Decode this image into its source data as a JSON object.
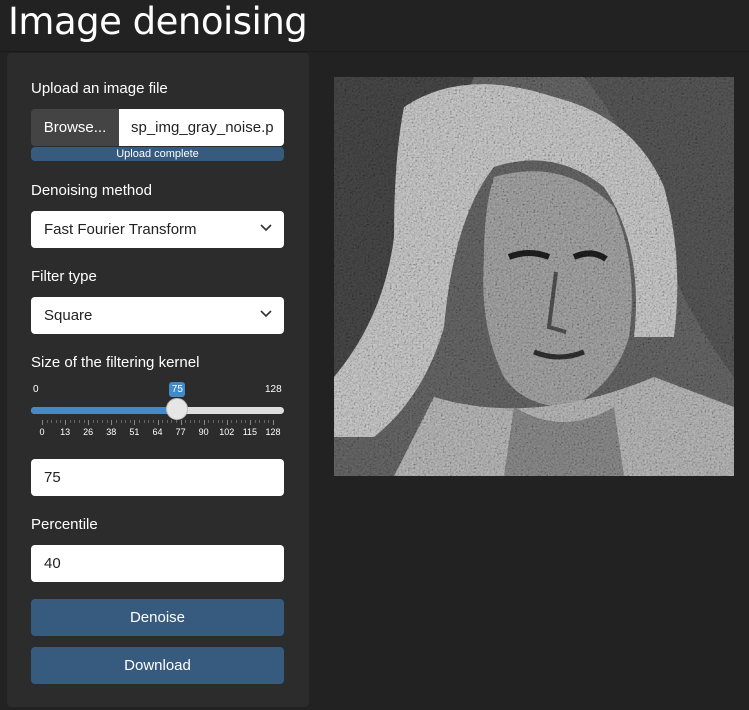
{
  "page": {
    "title": "Image denoising"
  },
  "upload": {
    "label": "Upload an image file",
    "browse_label": "Browse...",
    "filename": "sp_img_gray_noise.p",
    "progress_text": "Upload complete",
    "progress": 1.0
  },
  "method": {
    "label": "Denoising method",
    "value": "Fast Fourier Transform",
    "icon": "chevron-down-icon"
  },
  "filter": {
    "label": "Filter type",
    "value": "Square",
    "icon": "chevron-down-icon"
  },
  "kernel": {
    "label": "Size of the filtering kernel",
    "min": "0",
    "max": "128",
    "value": "75",
    "ticks": [
      "0",
      "13",
      "26",
      "38",
      "51",
      "64",
      "77",
      "90",
      "102",
      "115",
      "128"
    ],
    "input_value": "75"
  },
  "percentile": {
    "label": "Percentile",
    "value": "40"
  },
  "buttons": {
    "denoise": "Denoise",
    "download": "Download"
  },
  "colors": {
    "accent": "#375a7f",
    "slider": "#428bca",
    "background": "#222222",
    "panel": "#2c2c2c"
  }
}
